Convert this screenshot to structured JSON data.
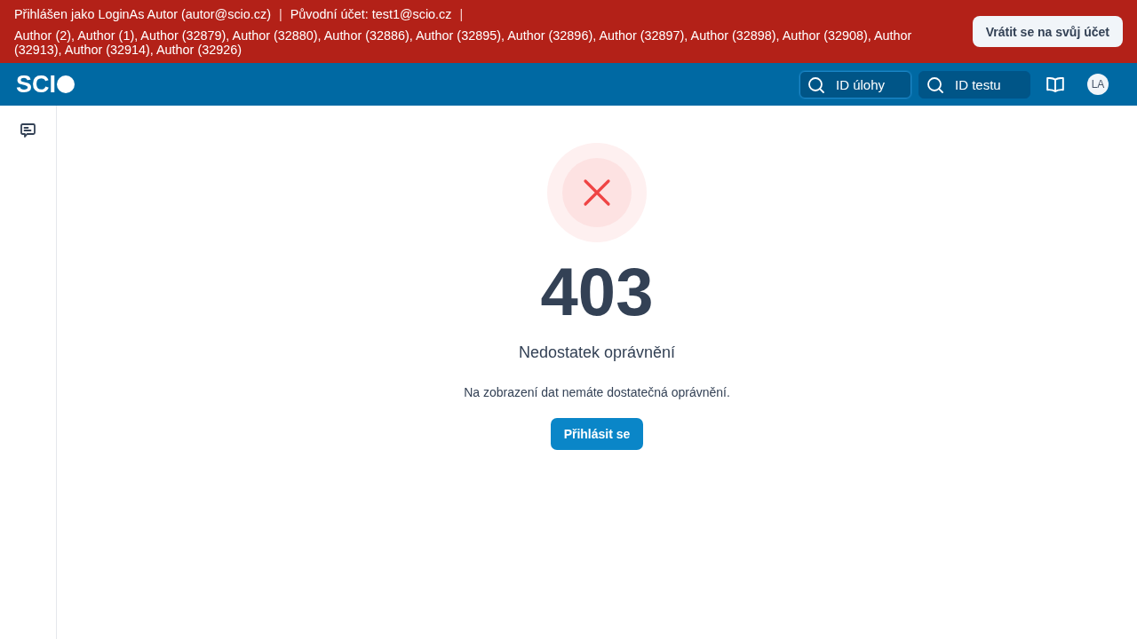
{
  "impersonation_banner": {
    "items": [
      {
        "text": "Přihlášen jako LoginAs Autor (autor@scio.cz)",
        "separator": "|"
      },
      {
        "text": "Původní účet: test1@scio.cz",
        "separator": "|"
      }
    ],
    "authors": "Author (2), Author (1), Author (32879), Author (32880), Author (32886), Author (32895), Author (32896), Author (32897), Author (32898), Author (32908), Author (32913), Author (32914), Author (32926)",
    "return_button": "Vrátit se na svůj účet"
  },
  "top_bar": {
    "logo": "SCI",
    "search_fields": [
      {
        "placeholder": "ID úlohy",
        "focused": true
      },
      {
        "placeholder": "ID testu",
        "focused": false
      }
    ],
    "avatar": "LA"
  },
  "error": {
    "code": "403",
    "title": "Nedostatek oprávnění",
    "message": "Na zobrazení dat nemáte dostatečná oprávnění.",
    "button": "Přihlásit se"
  }
}
